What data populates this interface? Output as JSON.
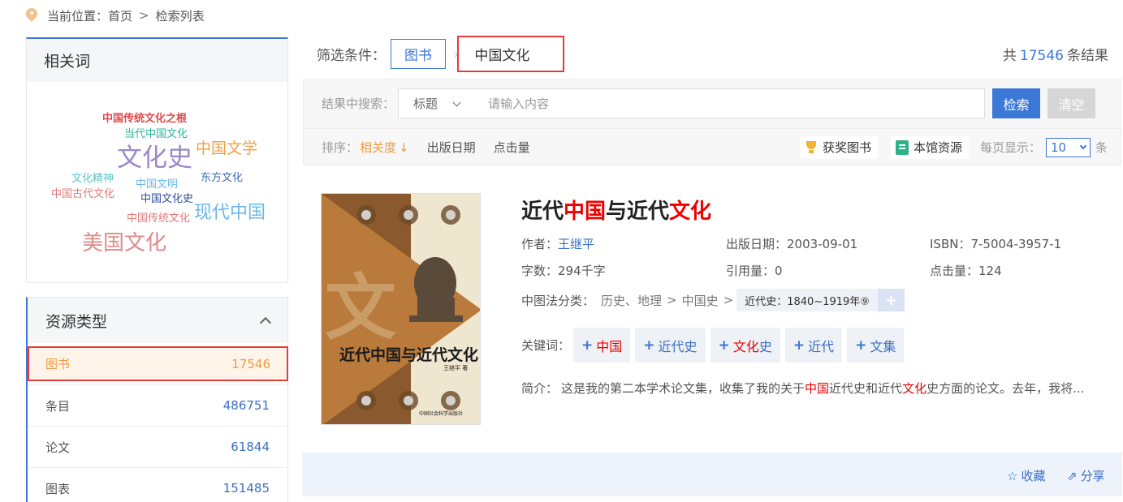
{
  "breadcrumb": {
    "label": "当前位置：",
    "home": "首页",
    "sep": ">",
    "current": "检索列表"
  },
  "related": {
    "title": "相关词",
    "words": [
      {
        "text": "中国传统文化之根",
        "color": "#e04a4a"
      },
      {
        "text": "当代中国文化",
        "color": "#2cb59b"
      },
      {
        "text": "文化史",
        "color": "#9a87c9"
      },
      {
        "text": "中国文学",
        "color": "#f0a040"
      },
      {
        "text": "文化精神",
        "color": "#5cc7c7"
      },
      {
        "text": "中国文明",
        "color": "#6bb8e6"
      },
      {
        "text": "东方文化",
        "color": "#3a6bb5"
      },
      {
        "text": "中国古代文化",
        "color": "#e07a7a"
      },
      {
        "text": "中国文化史",
        "color": "#2d4f9e"
      },
      {
        "text": "现代中国",
        "color": "#6bb8e6"
      },
      {
        "text": "中国传统文化",
        "color": "#e07a7a"
      },
      {
        "text": "美国文化",
        "color": "#e08a8a"
      }
    ]
  },
  "resource_types": {
    "title": "资源类型",
    "items": [
      {
        "label": "图书",
        "count": "17546"
      },
      {
        "label": "条目",
        "count": "486751"
      },
      {
        "label": "论文",
        "count": "61844"
      },
      {
        "label": "图表",
        "count": "151485"
      }
    ]
  },
  "filter": {
    "label": "筛选条件：",
    "type_chip": "图书",
    "query_chip": "中国文化",
    "total_prefix": "共",
    "total": "17546",
    "total_suffix": "条结果"
  },
  "search": {
    "label": "结果中搜索：",
    "field_select": "标题",
    "placeholder": "请输入内容",
    "search_button": "检索",
    "clear_button": "清空"
  },
  "sort": {
    "label": "排序：",
    "active": "相关度",
    "items": [
      "出版日期",
      "点击量"
    ],
    "award_books": "获奖图书",
    "library_resources": "本馆资源",
    "per_page_label": "每页显示：",
    "per_page_value": "10",
    "per_page_unit": "条"
  },
  "record": {
    "title_parts": [
      "近代",
      "中国",
      "与近代",
      "文化"
    ],
    "author_label": "作者：",
    "author": "王继平",
    "pubdate_label": "出版日期：",
    "pubdate": "2003-09-01",
    "isbn_label": "ISBN：",
    "isbn": "7-5004-3957-1",
    "words_label": "字数：",
    "words": "294千字",
    "cited_label": "引用量：",
    "cited": "0",
    "clicks_label": "点击量：",
    "clicks": "124",
    "class_label": "中图法分类：",
    "class_path": [
      "历史、地理",
      "中国史"
    ],
    "class_sep": ">",
    "class_tag": "近代史：1840~1919年⑨",
    "keywords_label": "关键词：",
    "keywords": [
      "中国",
      "近代史",
      "文化史",
      "近代",
      "文集"
    ],
    "summary_label": "简介：",
    "summary_parts": [
      "这是我的第二本学术论文集，收集了我的关于",
      "中国",
      "近代史和近代",
      "文化",
      "史方面的论文。去年，我将..."
    ],
    "cover_title": "近代中国与近代文化",
    "cover_big_char": "文",
    "cover_author": "王继平 著",
    "cover_publisher": "中国社会科学出版社"
  },
  "actions": {
    "favorite": "收藏",
    "share": "分享"
  }
}
